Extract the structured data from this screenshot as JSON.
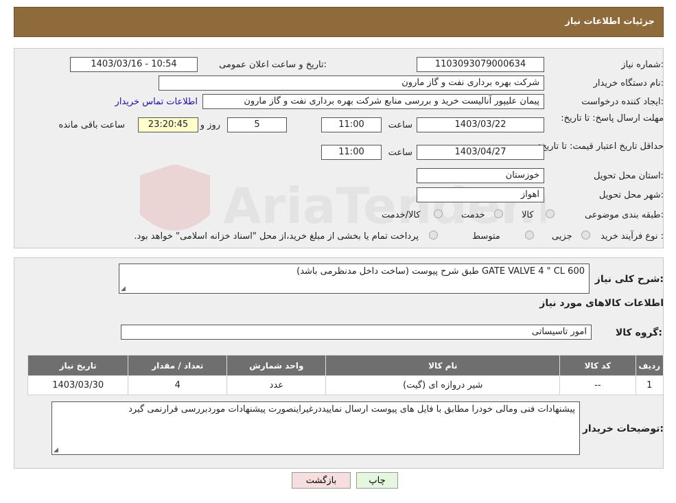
{
  "header": {
    "title": "جزئیات اطلاعات نیاز"
  },
  "details": {
    "need_number_label": "شماره نیاز:",
    "need_number": "1103093079000634",
    "announce_label": "تاریخ و ساعت اعلان عمومی:",
    "announce_value": "1403/03/16 - 10:54",
    "buyer_org_label": "نام دستگاه خریدار:",
    "buyer_org": "شرکت بهره برداری نفت و گاز مارون",
    "creator_label": "ایجاد کننده درخواست:",
    "creator": "پیمان علیپور آنالیست خرید و بررسی منابع شرکت بهره برداری نفت و گاز مارون",
    "contact_link": "اطلاعات تماس خریدار",
    "reply_deadline_label": "مهلت ارسال پاسخ: تا تاریخ:",
    "reply_date": "1403/03/22",
    "time_label": "ساعت",
    "reply_time": "11:00",
    "days": "5",
    "days_label": "روز و",
    "remaining": "23:20:45",
    "remaining_label": "ساعت باقی مانده",
    "price_validity_label": "حداقل تاریخ اعتبار قیمت: تا تاریخ:",
    "validity_date": "1403/04/27",
    "validity_time": "11:00",
    "province_label": "استان محل تحویل:",
    "province": "خوزستان",
    "city_label": "شهر محل تحویل:",
    "city": "اهواز",
    "category_label": "طبقه بندی موضوعی:",
    "category_options": [
      "کالا",
      "خدمت",
      "کالا/خدمت"
    ],
    "process_label": "نوع فرآیند خرید :",
    "process_options": [
      "جزیی",
      "متوسط"
    ],
    "payment_note": "پرداخت تمام یا بخشی از مبلغ خرید،از محل \"اسناد خزانه اسلامی\" خواهد بود."
  },
  "summary": {
    "description_label": "شرح کلی نیاز:",
    "description": "GATE VALVE 4 \" CL 600 طبق شرح پیوست (ساخت داخل مدنظرمی باشد)",
    "items_title": "اطلاعات کالاهای مورد نیاز",
    "group_label": "گروه کالا:",
    "group": "امور تاسیساتی"
  },
  "table": {
    "headers": [
      "ردیف",
      "کد کالا",
      "نام کالا",
      "واحد شمارش",
      "تعداد / مقدار",
      "تاریخ نیاز"
    ],
    "rows": [
      [
        "1",
        "--",
        "شیر دروازه ای (گیت)",
        "عدد",
        "4",
        "1403/03/30"
      ]
    ]
  },
  "buyer_notes": {
    "label": "توضیحات خریدار:",
    "text": "پیشنهادات فنی ومالی خودرا  مطابق با فایل های پیوست ارسال نماییددرغیراینصورت پیشنهادات موردبررسی قرارنمی گیرد"
  },
  "buttons": {
    "print": "چاپ",
    "back": "بازگشت"
  },
  "watermark": {
    "text": "AriaTender.neT"
  },
  "colors": {
    "header": "#8f6b3b",
    "table_header": "#6f6f6f",
    "remaining_bg": "#ffffcc",
    "back_btn": "#f7dede",
    "print_btn": "#e4f7de"
  }
}
